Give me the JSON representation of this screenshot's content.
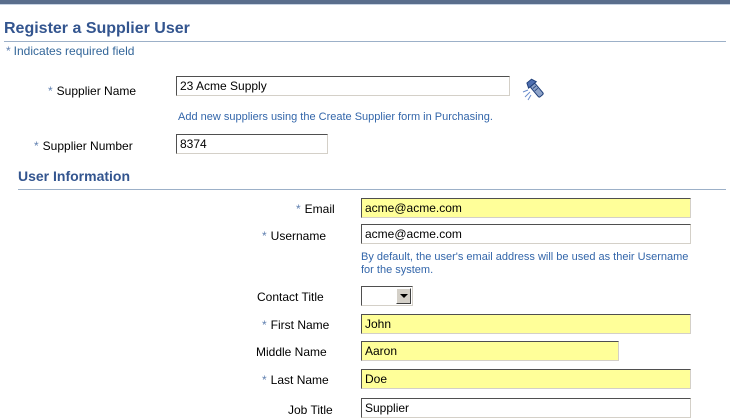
{
  "page": {
    "title": "Register a Supplier User"
  },
  "required_note": "Indicates required field",
  "required_marker": "*",
  "supplier": {
    "name_label": "Supplier Name",
    "name_value": "23 Acme Supply",
    "name_hint": "Add new suppliers using the Create Supplier form in Purchasing.",
    "number_label": "Supplier Number",
    "number_value": "8374",
    "search_icon": "flashlight-search-icon"
  },
  "user_info": {
    "title": "User Information",
    "email_label": "Email",
    "email_value": "acme@acme.com",
    "username_label": "Username",
    "username_value": "acme@acme.com",
    "username_hint": "By default, the user's email address will be used as their Username for the system.",
    "contact_title_label": "Contact Title",
    "contact_title_value": "",
    "first_name_label": "First Name",
    "first_name_value": "John",
    "middle_name_label": "Middle Name",
    "middle_name_value": "Aaron",
    "last_name_label": "Last Name",
    "last_name_value": "Doe",
    "job_title_label": "Job Title",
    "job_title_value": "Supplier"
  },
  "colors": {
    "header_text": "#33558f",
    "required_bg": "#ffff99",
    "hint_text": "#3366aa"
  }
}
